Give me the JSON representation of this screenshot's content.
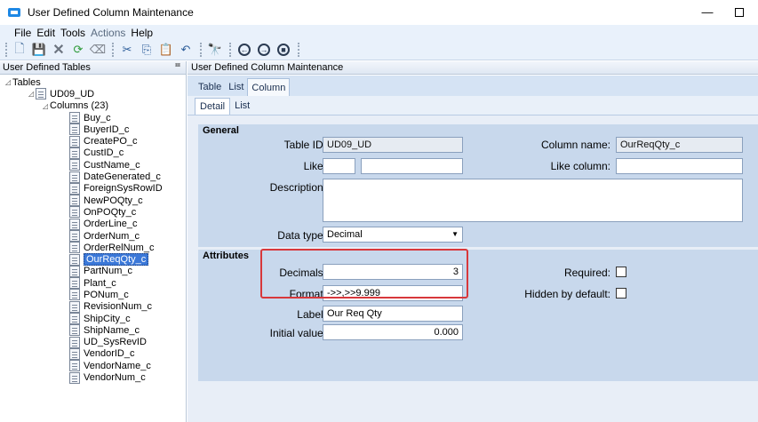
{
  "window": {
    "title": "User Defined Column Maintenance",
    "minimize": "—"
  },
  "menu": {
    "items": [
      "File",
      "Edit",
      "Tools",
      "Actions",
      "Help"
    ]
  },
  "toolbar": {
    "icons": [
      "new-icon",
      "save-icon",
      "delete-icon",
      "refresh-icon",
      "clear-icon",
      "cut-icon",
      "copy-icon",
      "paste-icon",
      "undo-icon",
      "find-icon",
      "prev-icon",
      "next-icon",
      "stop-icon"
    ]
  },
  "left": {
    "header": "User Defined Tables",
    "pin": "ⱎ",
    "root": "Tables",
    "table": "UD09_UD",
    "columns_label": "Columns (23)",
    "columns": [
      "Buy_c",
      "BuyerID_c",
      "CreatePO_c",
      "CustID_c",
      "CustName_c",
      "DateGenerated_c",
      "ForeignSysRowID",
      "NewPOQty_c",
      "OnPOQty_c",
      "OrderLine_c",
      "OrderNum_c",
      "OrderRelNum_c",
      "OurReqQty_c",
      "PartNum_c",
      "Plant_c",
      "PONum_c",
      "RevisionNum_c",
      "ShipCity_c",
      "ShipName_c",
      "UD_SysRevID",
      "VendorID_c",
      "VendorName_c",
      "VendorNum_c"
    ],
    "selected_index": 12
  },
  "right": {
    "header": "User Defined Column Maintenance",
    "tabs": [
      "Table",
      "List",
      "Column"
    ],
    "active_tab": 2,
    "subtabs": [
      "Detail",
      "List"
    ],
    "active_subtab": 0
  },
  "general": {
    "title": "General",
    "table_id_label": "Table ID:",
    "table_id": "UD09_UD",
    "column_name_label": "Column name:",
    "column_name": "OurReqQty_c",
    "like_label": "Like:",
    "like_value": "",
    "like_extra": "",
    "like_column_label": "Like column:",
    "like_column": "",
    "description_label": "Description:",
    "description": "",
    "data_type_label": "Data type:",
    "data_type": "Decimal"
  },
  "attributes": {
    "title": "Attributes",
    "decimals_label": "Decimals:",
    "decimals": "3",
    "format_label": "Format:",
    "format": "->>,>>9.999",
    "label_label": "Label:",
    "label": "Our Req Qty",
    "initial_value_label": "Initial value:",
    "initial_value": "0.000",
    "required_label": "Required:",
    "hidden_label": "Hidden by default:"
  },
  "colors": {
    "highlight": "#d8383b",
    "selection": "#3b78d8"
  }
}
